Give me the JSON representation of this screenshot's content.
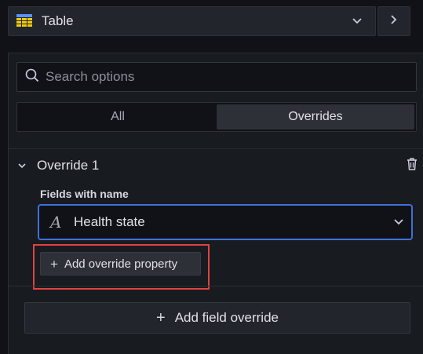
{
  "viz_picker": {
    "label": "Table"
  },
  "search": {
    "placeholder": "Search options"
  },
  "tabs": [
    {
      "label": "All",
      "active": false
    },
    {
      "label": "Overrides",
      "active": true
    }
  ],
  "override": {
    "title": "Override 1",
    "matcher_label": "Fields with name",
    "matcher_value": "Health state",
    "field_type_glyph": "A",
    "add_property_label": "Add override property"
  },
  "add_field_override_label": "Add field override",
  "colors": {
    "background": "#111217",
    "panel": "#181b1f",
    "focus_border": "#3d71d9",
    "highlight": "#e0433f",
    "table_icon": "#5b8ff9"
  },
  "icons": [
    "table-icon",
    "chevron-down-icon",
    "chevron-right-icon",
    "search-icon",
    "chevron-collapse-icon",
    "trash-icon",
    "plus-icon"
  ]
}
